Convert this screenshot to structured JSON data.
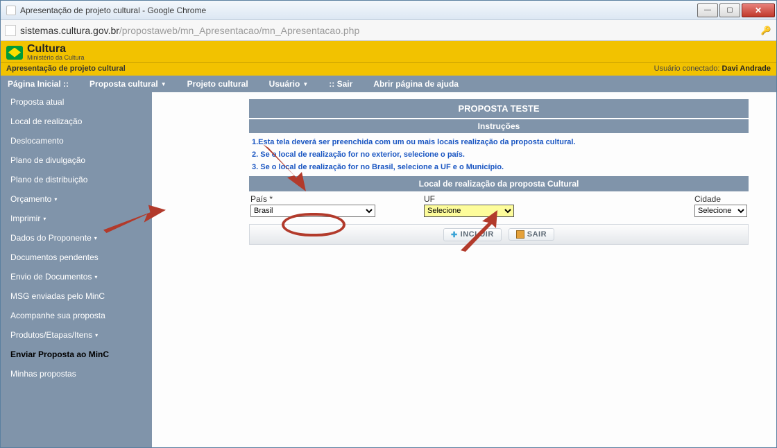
{
  "window": {
    "title": "Apresentação de projeto cultural - Google Chrome"
  },
  "address": {
    "host": "sistemas.cultura.gov.br",
    "path": "/propostaweb/mn_Apresentacao/mn_Apresentacao.php"
  },
  "brand": {
    "name": "Cultura",
    "subtitle": "Ministério da Cultura",
    "pageName": "Apresentação de projeto cultural"
  },
  "user": {
    "label": "Usuário conectado:",
    "name": "Davi Andrade"
  },
  "topnav": {
    "home": "Página Inicial ::",
    "proposta_cultural": "Proposta cultural",
    "projeto_cultural": "Projeto cultural",
    "usuario": "Usuário",
    "sair": ":: Sair",
    "ajuda": "Abrir página de ajuda"
  },
  "sidebar": {
    "items": [
      {
        "label": "Proposta atual"
      },
      {
        "label": "Local de realização"
      },
      {
        "label": "Deslocamento"
      },
      {
        "label": "Plano de divulgação"
      },
      {
        "label": "Plano de distribuição"
      },
      {
        "label": "Orçamento",
        "caret": true
      },
      {
        "label": "Imprimir",
        "caret": true
      },
      {
        "label": "Dados do Proponente",
        "caret": true
      },
      {
        "label": "Documentos pendentes"
      },
      {
        "label": "Envio de Documentos",
        "caret": true
      },
      {
        "label": "MSG enviadas pelo MinC"
      },
      {
        "label": "Acompanhe sua proposta"
      },
      {
        "label": "Produtos/Etapas/Itens",
        "caret": true
      },
      {
        "label": "Enviar Proposta ao MinC",
        "active": true
      },
      {
        "label": "Minhas propostas"
      }
    ]
  },
  "panel": {
    "title": "PROPOSTA TESTE",
    "instructions_header": "Instruções",
    "instructions": [
      "1.Esta tela deverá ser preenchida com um ou mais locais realização da proposta cultural.",
      "2. Se o local de realização for no exterior, selecione o país.",
      "3. Se o local de realização for no Brasil, selecione a UF e o Município."
    ],
    "section_header": "Local de realização da proposta Cultural",
    "fields": {
      "pais_label": "País *",
      "pais_value": "Brasil",
      "uf_label": "UF",
      "uf_value": "Selecione",
      "cidade_label": "Cidade",
      "cidade_value": "Selecione"
    },
    "buttons": {
      "incluir": "INCLUIR",
      "sair": "SAIR"
    }
  }
}
